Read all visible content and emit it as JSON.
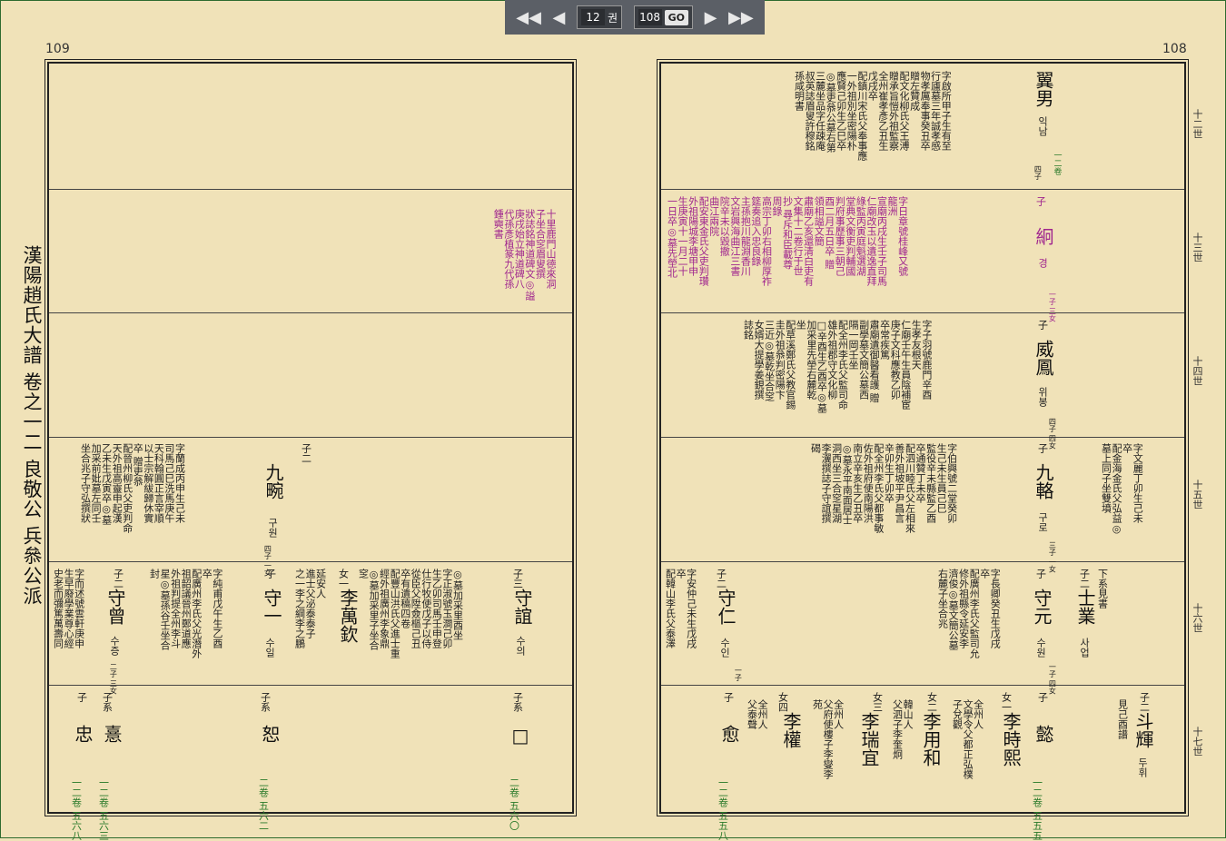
{
  "nav": {
    "vol": "12",
    "vol_unit": "권",
    "page": "108",
    "go": "GO"
  },
  "pages": {
    "left": "109",
    "right": "108"
  },
  "title": "漢陽趙氏大譜 卷之一二 良敬公 兵叅公派",
  "gens": [
    "十二世",
    "十三世",
    "十四世",
    "十五世",
    "十六世",
    "十七世"
  ],
  "left": {
    "r2": "十里鹿門山德來洞\n子坐合窆眉叟撰\n狀誌銘神道碑文◎謚\n庚戌始立神道碑八\n代孫彥植篆九代孫\n鍾奭書",
    "r4": {
      "rel": "子二",
      "name": "九畹",
      "kor": "구원",
      "tag": "四子 一女",
      "text": "字蘭成丙申生己未\n司馬己巳洗馬庚午\n天科翰圓正言宰順\n以士宗解紱歸休實\n卒 贈吏叅\n配晉州柳氏父吏判命\n天外祖高靈申起漢\n乙未生戊寅卒◎墓\n加采前妣墓左同壬\n坐合兆子守弘撰狀"
    },
    "r5": [
      {
        "rel": "子三",
        "name": "守誼",
        "kor": "수의",
        "text": "◎墓加采里酉坐\n字正淑號玉澗己卯\n生乙卯司馬壬申登\n仕行牧使戊子以侍\n從臣父陞僉樞己丑\n卒有遺稿四卷\n配豐山洪氏父進士重\n經外祖廣州李象鼎\n◎墓加采里子坐合\n窆"
      },
      {
        "rel": "女一",
        "name": "李萬欽",
        "text": "延安人\n進士父泌泰泰子\n之一李之綱李之鵬"
      },
      {
        "rel": "子",
        "name": "守一",
        "kor": "수일",
        "text": "字純甫戊午生乙酉\n卒\n配廣州李氏父光潛外\n祖韶議晉州鄭道應\n外祖判提全州李斗\n星◎墓孫谷壬坐合\n封"
      },
      {
        "rel": "子二",
        "name": "守曾",
        "kor": "수증",
        "tag": "二子 三女",
        "text": "字而述號雲軒庚申\n生早廢學業尊心經\n史老而彌篤萬壽同"
      }
    ],
    "r6": [
      {
        "rel": "子系",
        "name": "□",
        "ref": "二卷 五六〇"
      },
      {
        "rel": "子系",
        "name": "恕",
        "ref": "二卷 五六二"
      },
      {
        "rel": "子系",
        "name": "憙",
        "ref": "一二卷 五六三"
      },
      {
        "rel": "子",
        "name": "忠",
        "ref": "一二卷 五六八"
      }
    ]
  },
  "right": {
    "r1": {
      "name": "翼男",
      "kor": "익남",
      "tag": "四子",
      "ref": "一二卷",
      "text": "字啟所甲子生有至\n行廬墓三年誠孝感\n物孝厲奉事癸丑卒\n贈左贊成\n配文化柳氏父王溥\n贈承旨愷外祖監察\n全州崔孝彥乙丑生\n戊戌卒\n配鎮川宋氏父奉事應\n一外祖別坐密陽朴\n應賢己卯生乙巳卒\n◎墓吏叅公墓右第\n三麓坐品字任疎庵\n叔英誌眉叟許穆銘\n孫咸明書"
    },
    "r2": {
      "rel": "子",
      "name": "絅",
      "kor": "경",
      "tag": "一子 三女",
      "text": "字日章號桂峰又號\n龍洲\n宣廟丙戌生壬子司馬\n仁廟改玉以遺逸直拜\n綠監丙寅庭魁選湖\n堂典文衡吏判輔國\n判府事歷事三朝己\n酉二月五日卒 贈\n領相謚文簡\n肅廟乙亥還清白吏有\n文集十二卷行于世\n抄 尋斥和臣載尊\n周錄\n高宗丁卯右相柳厚祚\n筵奏追入忠良錄\n主孫抱川龍淵香川\n文岩興海曲江三書\n院辛未以毀撤\n曲江兩院\n配安東金氏父吏判瓚\n外祖陽城李塘甲申\n生庚寅十一月二十\n一日卒◎墓先塋北"
    },
    "r3": {
      "rel": "子",
      "name": "威鳳",
      "kor": "위봉",
      "tag": "四子 四女",
      "text": "字子羽號鹿門辛酉\n生孝友根天\n仁廟壬午生員陰補宦\n庚子文科應教乙卯\n卒常疾篤\n肅廟遺御醫看護 贈\n副學墓文簡公墓西\n隔一岡壬坐\n配全州李氏父監司命\n雄外祖郡守文化柳\n□辛酉生乙酉卒◎墓\n加采里先塋右麓乾\n坐\n配草溪鄭氏父教官錫\n圭外祖叅判密陽卞\n三近◎墓乾坐合窆\n女婿大提學姜鋧撰\n誌銘"
    },
    "r4": {
      "rel": "子",
      "name": "九輅",
      "kor": "구로",
      "tag": "三子 一女",
      "text": "字伯興號二堂癸卯\n生己未生員己巳\n監役辛未縣監乙酉\n卒通贊丁未卒\n配泗川睦氏父左相來\n善外祖坡平尹昌言\n辛卯生丁卯卒\n配全州李氏父都事敏\n佐外祖府使南陽洪\n南立辛亥生乙丑卒\n◎墓永平南面居士\n洞西坐三合窆星湖\n李瀷撰誌子守誼撰\n碣"
    },
    "r5": [
      {
        "rel": "子",
        "name": "守元",
        "kor": "수원",
        "tag": "一子 四女",
        "text": "字長卿癸丑生戊戌\n卒\n配廣州李氏父監司允\n修外祖縣令延安李\n濟俊◎墓文簡公墓\n右麓子坐合兆"
      },
      {
        "rel": "子二",
        "name": "士業",
        "kor": "사업",
        "text": "下系見書"
      },
      {
        "rel": "子二",
        "name": "守仁",
        "kor": "수인",
        "tag": "一子",
        "text": "字安仲己未生戊戌\n卒\n配韓山李氏父泰澤"
      },
      {
        "rel": "",
        "name": "",
        "text": "字文麗丁卯生己未\n卒\n配金海金氏父弘益◎\n墓上同子坐雙墳"
      }
    ],
    "r6": [
      {
        "rel": "子二",
        "name": "斗輝",
        "kor": "두휘",
        "sub": "見己酉譜"
      },
      {
        "rel": "子",
        "name": "懿",
        "ref": "一二卷 五五五"
      },
      {
        "rel": "女一",
        "name": "李時熙",
        "sub": "全州人\n文學令父都正弘樸\n子兌觀"
      },
      {
        "rel": "女二",
        "name": "李用和",
        "sub": "韓山人\n父泗子李奎炯"
      },
      {
        "rel": "女三",
        "name": "李瑞宜",
        "sub": "全州人\n父府使樓子李燮李\n苑"
      },
      {
        "rel": "女四",
        "name": "李權",
        "sub": "全州人\n父泰聲"
      },
      {
        "rel": "子",
        "name": "愈",
        "ref": "一二卷 五五八"
      }
    ]
  }
}
